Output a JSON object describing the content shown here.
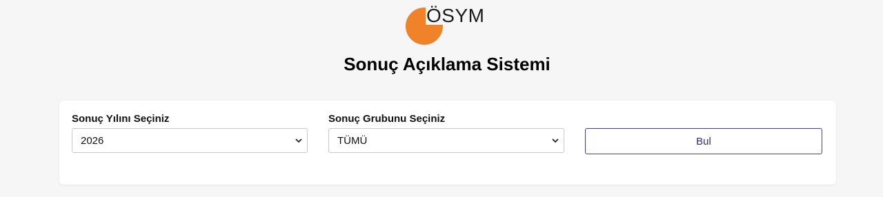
{
  "logo": {
    "text": "ÖSYM",
    "accent": "#f0822a"
  },
  "page": {
    "title": "Sonuç Açıklama Sistemi"
  },
  "form": {
    "year": {
      "label": "Sonuç Yılını Seçiniz",
      "value": "2026"
    },
    "group": {
      "label": "Sonuç Grubunu Seçiniz",
      "value": "TÜMÜ"
    },
    "submit_label": "Bul"
  },
  "colors": {
    "button_border": "#3b3f9a",
    "background": "#f6f6f6"
  }
}
